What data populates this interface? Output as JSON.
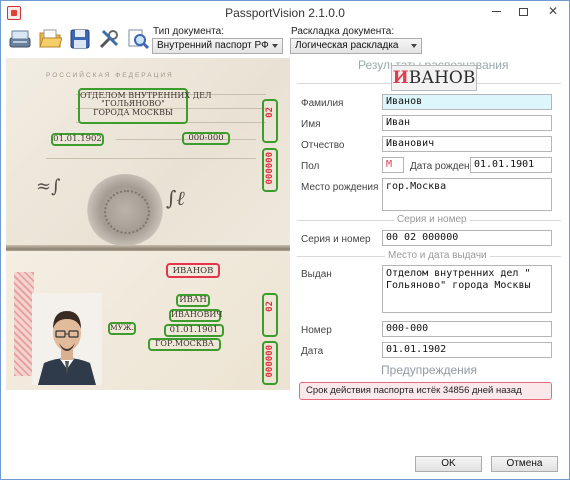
{
  "window": {
    "title": "PassportVision 2.1.0.0"
  },
  "toolbar": {
    "icons": [
      "scanner-icon",
      "open-folder-icon",
      "save-icon",
      "tools-icon",
      "search-document-icon"
    ],
    "doc_type_label": "Тип документа:",
    "doc_type_value": "Внутренний паспорт РФ",
    "layout_label": "Раскладка документа:",
    "layout_value": "Логическая раскладка"
  },
  "passport_image": {
    "header": "РОССИЙСКАЯ ФЕДЕРАЦИЯ",
    "issued_by": [
      "ОТДЕЛОМ ВНУТРЕННИХ ДЕЛ",
      "\"ГОЛЬЯНОВО\"",
      "ГОРОДА МОСКВЫ"
    ],
    "issue_date": "01.01.1902",
    "dept_code": "000-000",
    "series_digits": "02",
    "number_digits": "000000",
    "surname": "ИВАНОВ",
    "name": "ИВАН",
    "patronymic": "ИВАНОВИЧ",
    "sex": "МУЖ.",
    "birth_date": "01.01.1901",
    "birth_place": "ГОР.МОСКВА"
  },
  "results": {
    "title": "Результаты распознавания",
    "surname_preview": "ИВАНОВ",
    "surname_preview_first": "И",
    "surname_preview_rest": "ВАНОВ",
    "surname_label": "Фамилия",
    "surname_value": "Иванов",
    "name_label": "Имя",
    "name_value": "Иван",
    "patronymic_label": "Отчество",
    "patronymic_value": "Иванович",
    "sex_label": "Пол",
    "sex_value": "М",
    "birth_date_label": "Дата рождения",
    "birth_date_value": "01.01.1901",
    "birth_place_label": "Место рождения",
    "birth_place_value": "гор.Москва",
    "series_section": "Серия и номер",
    "series_label": "Серия и номер",
    "series_value": "00 02 000000",
    "issue_section": "Место и дата выдачи",
    "issued_by_label": "Выдан",
    "issued_by_value": "Отделом внутренних дел \" Гольяново\" города Москвы",
    "code_label": "Номер",
    "code_value": "000-000",
    "date_label": "Дата",
    "date_value": "01.01.1902"
  },
  "warnings": {
    "title": "Предупреждения",
    "message": "Срок действия паспорта истёк 34856 дней назад"
  },
  "buttons": {
    "ok": "OK",
    "cancel": "Отмена"
  },
  "colors": {
    "highlight_green": "#3c9d2c",
    "highlight_red": "#e23d4f",
    "surname_field_bg": "#dcf6fb",
    "warning_bg": "#fbe8ea"
  }
}
